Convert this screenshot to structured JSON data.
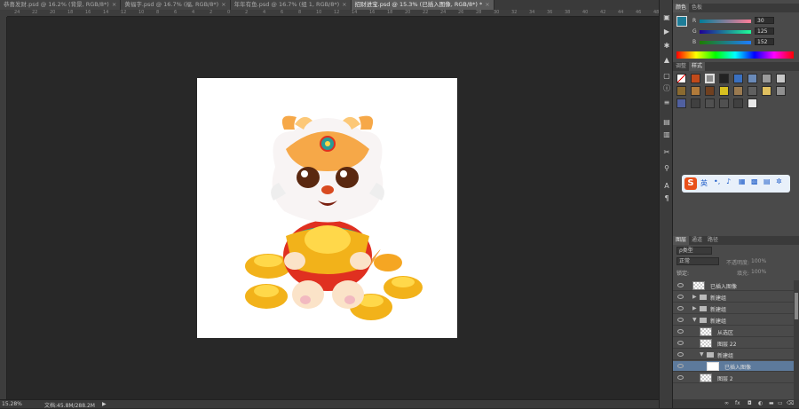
{
  "tabs": [
    {
      "label": "恭喜发财.psd @ 16.2% (背景, RGB/8*)",
      "active": false
    },
    {
      "label": "黄福字.psd @ 16.7% (福, RGB/8*)",
      "active": false
    },
    {
      "label": "年年有鱼.psd @ 16.7% (组 1, RGB/8*)",
      "active": false
    },
    {
      "label": "招财进宝.psd @ 15.3% (已插入图像, RGB/8*) *",
      "active": true
    }
  ],
  "ruler_h": [
    "24",
    "22",
    "20",
    "18",
    "16",
    "14",
    "12",
    "10",
    "8",
    "6",
    "4",
    "2",
    "0",
    "2",
    "4",
    "6",
    "8",
    "10",
    "12",
    "14",
    "16",
    "18",
    "20",
    "22",
    "24",
    "26",
    "28",
    "30",
    "32",
    "34",
    "36",
    "38",
    "40",
    "42",
    "44",
    "46",
    "48"
  ],
  "status": {
    "zoom": "15.28%",
    "doc": "文档:45.8M/288.2M"
  },
  "color_panel": {
    "tabs": [
      "颜色",
      "色板"
    ],
    "r": {
      "label": "R",
      "value": "30"
    },
    "g": {
      "label": "G",
      "value": "125"
    },
    "b": {
      "label": "B",
      "value": "152"
    },
    "fg_color": "#1e7d98"
  },
  "adjust_panel": {
    "tabs": [
      "调整",
      "样式"
    ]
  },
  "ime_bar": {
    "label": "英"
  },
  "layers_panel": {
    "tabs": [
      "图层",
      "通道",
      "路径"
    ],
    "filter_label": "ρ类型",
    "blend_mode": "正常",
    "opacity_label": "不透明度:",
    "opacity_value": "100%",
    "lock_label": "锁定:",
    "fill_label": "填充:",
    "fill_value": "100%",
    "layers": [
      {
        "name": "已插入图像",
        "kind": "image"
      },
      {
        "name": "新建组",
        "kind": "group-closed"
      },
      {
        "name": "新建组",
        "kind": "group-closed"
      },
      {
        "name": "新建组",
        "kind": "group-open"
      },
      {
        "name": "从选区",
        "kind": "image"
      },
      {
        "name": "图层 22",
        "kind": "image"
      },
      {
        "name": "新建组",
        "kind": "group-open"
      },
      {
        "name": "已插入图像",
        "kind": "image-selected"
      },
      {
        "name": "图层 2",
        "kind": "image"
      }
    ]
  }
}
